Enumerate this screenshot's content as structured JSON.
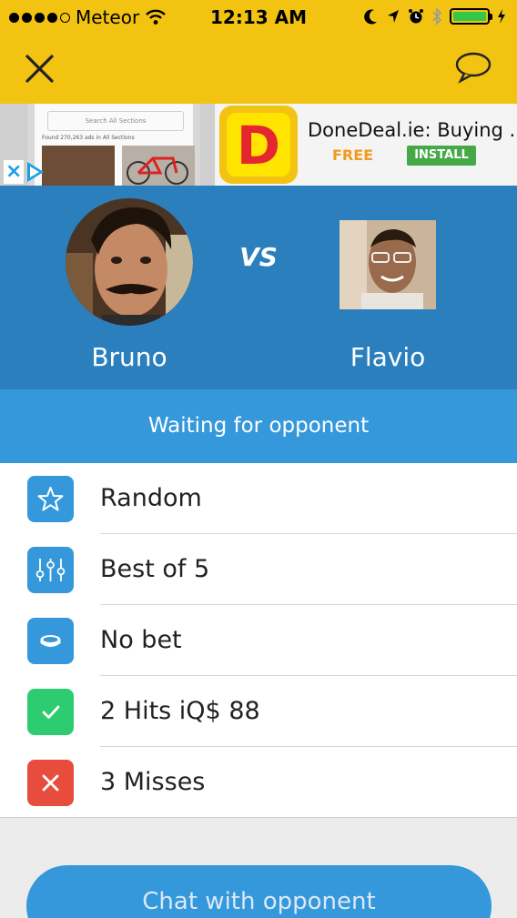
{
  "status_bar": {
    "carrier": "Meteor",
    "time": "12:13 AM"
  },
  "ad": {
    "search_placeholder": "Search All Sections",
    "found_text": "Found 270,263 ads in All Sections",
    "logo_letter": "D",
    "title": "DoneDeal.ie: Buying ...",
    "price": "FREE",
    "install_label": "INSTALL"
  },
  "versus": {
    "vs_label": "VS",
    "player_left": "Bruno",
    "player_right": "Flavio"
  },
  "waiting": "Waiting for opponent",
  "game_options": [
    {
      "label": "Random",
      "icon": "star-icon",
      "color": "#3498db"
    },
    {
      "label": "Best of 5",
      "icon": "sliders-icon",
      "color": "#3498db"
    },
    {
      "label": "No bet",
      "icon": "coin-icon",
      "color": "#3498db"
    },
    {
      "label": "2 Hits iQ$ 88",
      "icon": "check-icon",
      "color": "#2ecc71"
    },
    {
      "label": "3 Misses",
      "icon": "cross-icon",
      "color": "#e74c3c"
    }
  ],
  "chat_button_label": "Chat with opponent",
  "colors": {
    "header_yellow": "#f2c311",
    "panel_blue": "#2b7fbd",
    "accent_blue": "#3498db",
    "success_green": "#2ecc71",
    "error_red": "#e74c3c"
  }
}
